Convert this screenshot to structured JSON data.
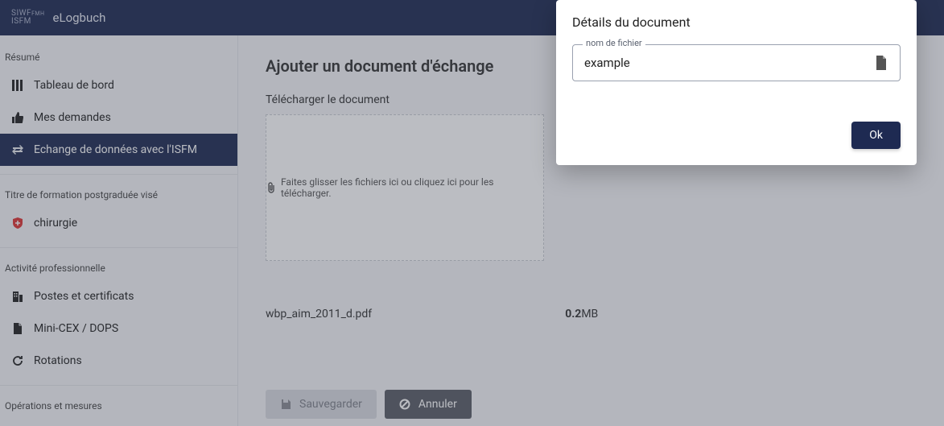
{
  "brand": {
    "prefix": "SIWF\nISFM",
    "name": "eLogbuch"
  },
  "sidebar": {
    "sections": [
      {
        "label": "Résumé",
        "items": [
          {
            "label": "Tableau de bord",
            "icon": "dashboard"
          },
          {
            "label": "Mes demandes",
            "icon": "thumb-up"
          },
          {
            "label": "Echange de données avec l'ISFM",
            "icon": "exchange",
            "active": true
          }
        ]
      },
      {
        "label": "Titre de formation postgraduée visé",
        "items": [
          {
            "label": "chirurgie",
            "icon": "shield"
          }
        ]
      },
      {
        "label": "Activité professionnelle",
        "items": [
          {
            "label": "Postes et certificats",
            "icon": "building"
          },
          {
            "label": "Mini-CEX / DOPS",
            "icon": "doc"
          },
          {
            "label": "Rotations",
            "icon": "refresh"
          }
        ]
      },
      {
        "label": "Opérations et mesures",
        "items": []
      }
    ]
  },
  "main": {
    "title": "Ajouter un document d'échange",
    "upload_label": "Télécharger le document",
    "dropzone_text": "Faites glisser les fichiers ici ou cliquez ici pour les télécharger.",
    "file": {
      "name": "wbp_aim_2011_d.pdf",
      "size_val": "0.2",
      "size_unit": "MB"
    },
    "save_label": "Sauvegarder",
    "cancel_label": "Annuler"
  },
  "modal": {
    "title": "Détails du document",
    "field_label": "nom de fichier",
    "field_value": "example",
    "ok_label": "Ok"
  }
}
